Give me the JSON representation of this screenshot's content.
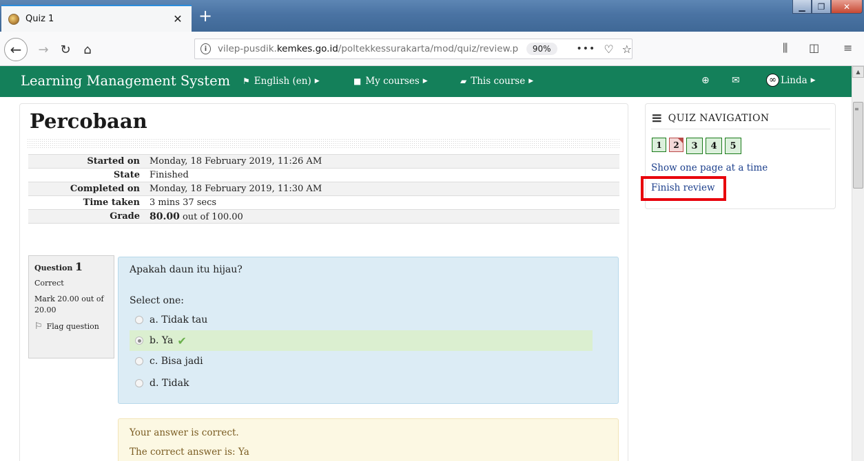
{
  "browser": {
    "tab_title": "Quiz 1",
    "tab_close": "✕",
    "new_tab": "+",
    "url_prefix": "vilep-pusdik.",
    "url_host": "kemkes.go.id",
    "url_path": "/poltekkessurakarta/mod/quiz/review.p",
    "zoom": "90%"
  },
  "moodle_nav": {
    "brand": "Learning Management System",
    "language": "English (en)",
    "my_courses": "My courses",
    "this_course": "This course",
    "user": "Linda"
  },
  "page": {
    "title": "Percobaan"
  },
  "summary": [
    {
      "label": "Started on",
      "value": "Monday, 18 February 2019, 11:26 AM"
    },
    {
      "label": "State",
      "value": "Finished"
    },
    {
      "label": "Completed on",
      "value": "Monday, 18 February 2019, 11:30 AM"
    },
    {
      "label": "Time taken",
      "value": "3 mins 37 secs"
    },
    {
      "label": "Grade",
      "value_bold": "80.00",
      "value_rest": " out of 100.00"
    }
  ],
  "question": {
    "label": "Question",
    "number": "1",
    "state": "Correct",
    "mark": "Mark 20.00 out of 20.00",
    "flag": "Flag question",
    "text": "Apakah daun itu hijau?",
    "prompt": "Select one:",
    "options": [
      "a. Tidak tau",
      "b. Ya",
      "c. Bisa jadi",
      "d. Tidak"
    ],
    "selected_index": 1
  },
  "feedback": {
    "line1": "Your answer is correct.",
    "line2": "The correct answer is: Ya"
  },
  "quiz_navigation": {
    "title": "QUIZ NAVIGATION",
    "buttons": [
      "1",
      "2",
      "3",
      "4",
      "5"
    ],
    "show_one_page": "Show one page at a time",
    "finish_review": "Finish review"
  },
  "colors": {
    "moodle_green": "#14805a",
    "highlight_red": "#e8000b",
    "question_bg": "#dcecf5",
    "correct_bg": "#dbefd0",
    "feedback_bg": "#fcf8e3"
  }
}
